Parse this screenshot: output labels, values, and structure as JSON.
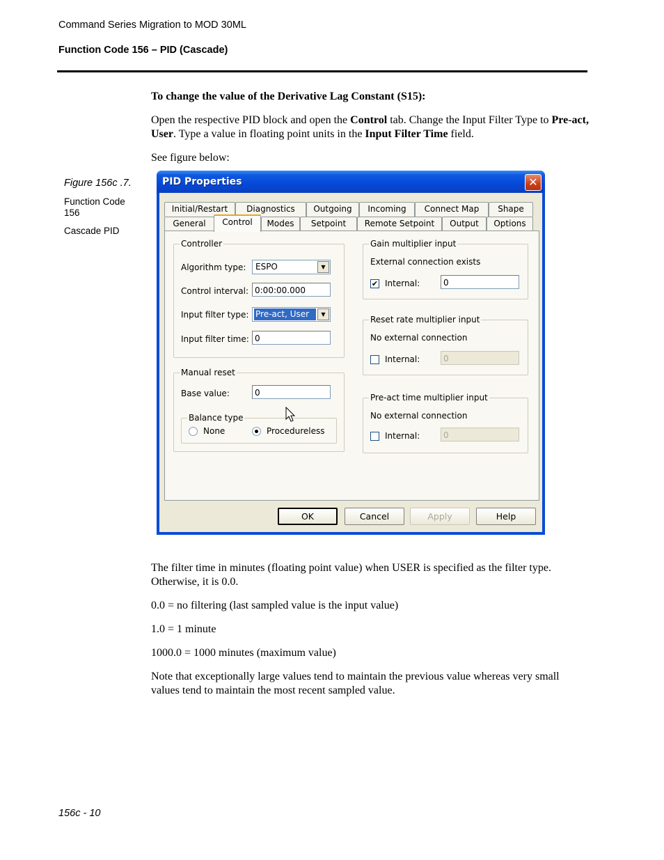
{
  "header": {
    "doc_title": "Command Series Migration to MOD 30ML",
    "section_title": "Function Code 156 – PID (Cascade)"
  },
  "instructions": {
    "heading": "To change the value of the Derivative Lag Constant (S15):",
    "para1_parts": [
      "Open the respective PID block and open the ",
      "Control",
      " tab. Change the Input Filter Type to ",
      "Pre-act, User",
      ". Type a value in floating point units in the ",
      "Input Filter Time",
      " field."
    ],
    "see_figure": "See figure below:"
  },
  "figure_caption": {
    "figure": "Figure 156c .7.",
    "function_code": "Function Code 156",
    "name": "Cascade PID"
  },
  "dialog": {
    "title": "PID Properties",
    "close_icon": "close-icon",
    "tabs_row1": [
      "Initial/Restart",
      "Diagnostics",
      "Outgoing",
      "Incoming",
      "Connect Map",
      "Shape"
    ],
    "tabs_row2": [
      "General",
      "Control",
      "Modes",
      "Setpoint",
      "Remote Setpoint",
      "Output",
      "Options"
    ],
    "active_tab": "Control",
    "controller": {
      "label": "Controller",
      "algorithm_type_label": "Algorithm type:",
      "algorithm_type_value": "ESPO",
      "control_interval_label": "Control interval:",
      "control_interval_value": "0:00:00.000",
      "input_filter_type_label": "Input filter type:",
      "input_filter_type_value": "Pre-act, User",
      "input_filter_time_label": "Input filter time:",
      "input_filter_time_value": "0"
    },
    "manual_reset": {
      "label": "Manual reset",
      "base_value_label": "Base value:",
      "base_value": "0",
      "balance_type_label": "Balance type",
      "option_none": "None",
      "option_procedureless": "Procedureless",
      "selected": "Procedureless"
    },
    "gain_multiplier": {
      "label": "Gain multiplier input",
      "status": "External connection exists",
      "internal_label": "Internal:",
      "internal_checked": true,
      "value": "0"
    },
    "reset_rate_multiplier": {
      "label": "Reset rate multiplier input",
      "status": "No external connection",
      "internal_label": "Internal:",
      "internal_checked": false,
      "value": "0"
    },
    "preact_time_multiplier": {
      "label": "Pre-act time multiplier input",
      "status": "No external connection",
      "internal_label": "Internal:",
      "internal_checked": false,
      "value": "0"
    },
    "buttons": {
      "ok": "OK",
      "cancel": "Cancel",
      "apply": "Apply",
      "help": "Help"
    }
  },
  "explanation": {
    "p1": "The filter time in minutes (floating point value) when USER is specified as the filter type. Otherwise, it is 0.0.",
    "p2": "0.0 = no filtering (last sampled value is the input value)",
    "p3": "1.0 = 1 minute",
    "p4": "1000.0 = 1000 minutes (maximum value)",
    "p5": "Note that exceptionally large values tend to maintain the previous value whereas very small values tend to maintain the most recent sampled value."
  },
  "footer": {
    "page_number": "156c - 10"
  }
}
